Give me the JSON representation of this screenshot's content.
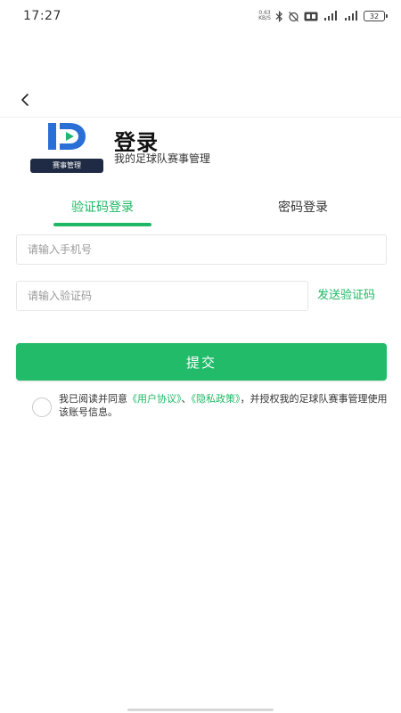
{
  "status_bar": {
    "time": "17:27",
    "net_speed_value": "0.63",
    "net_speed_unit": "KB/S",
    "battery": "32",
    "icons": [
      "bluetooth-icon",
      "alarm-off-icon",
      "hd-icon",
      "signal-icon",
      "signal-icon",
      "battery-icon"
    ]
  },
  "nav": {
    "back_icon": "chevron-left-icon"
  },
  "header": {
    "logo_caption": "赛事管理",
    "title": "登录",
    "subtitle": "我的足球队赛事管理"
  },
  "tabs": [
    {
      "label": "验证码登录",
      "active": true
    },
    {
      "label": "密码登录",
      "active": false
    }
  ],
  "form": {
    "phone_placeholder": "请输入手机号",
    "code_placeholder": "请输入验证码",
    "send_code_label": "发送验证码",
    "submit_label": "提交"
  },
  "agreement": {
    "prefix": "我已阅读并同意",
    "user_agreement": "《用户协议》",
    "separator": "、",
    "privacy_policy": "《隐私政策》",
    "suffix": "，并授权我的足球队赛事管理使用该账号信息。"
  },
  "colors": {
    "accent": "#1fb864",
    "button": "#21bb6a",
    "logo_blue": "#2a6fd6",
    "logo_green": "#22b573",
    "logo_dark": "#1f2a44"
  }
}
